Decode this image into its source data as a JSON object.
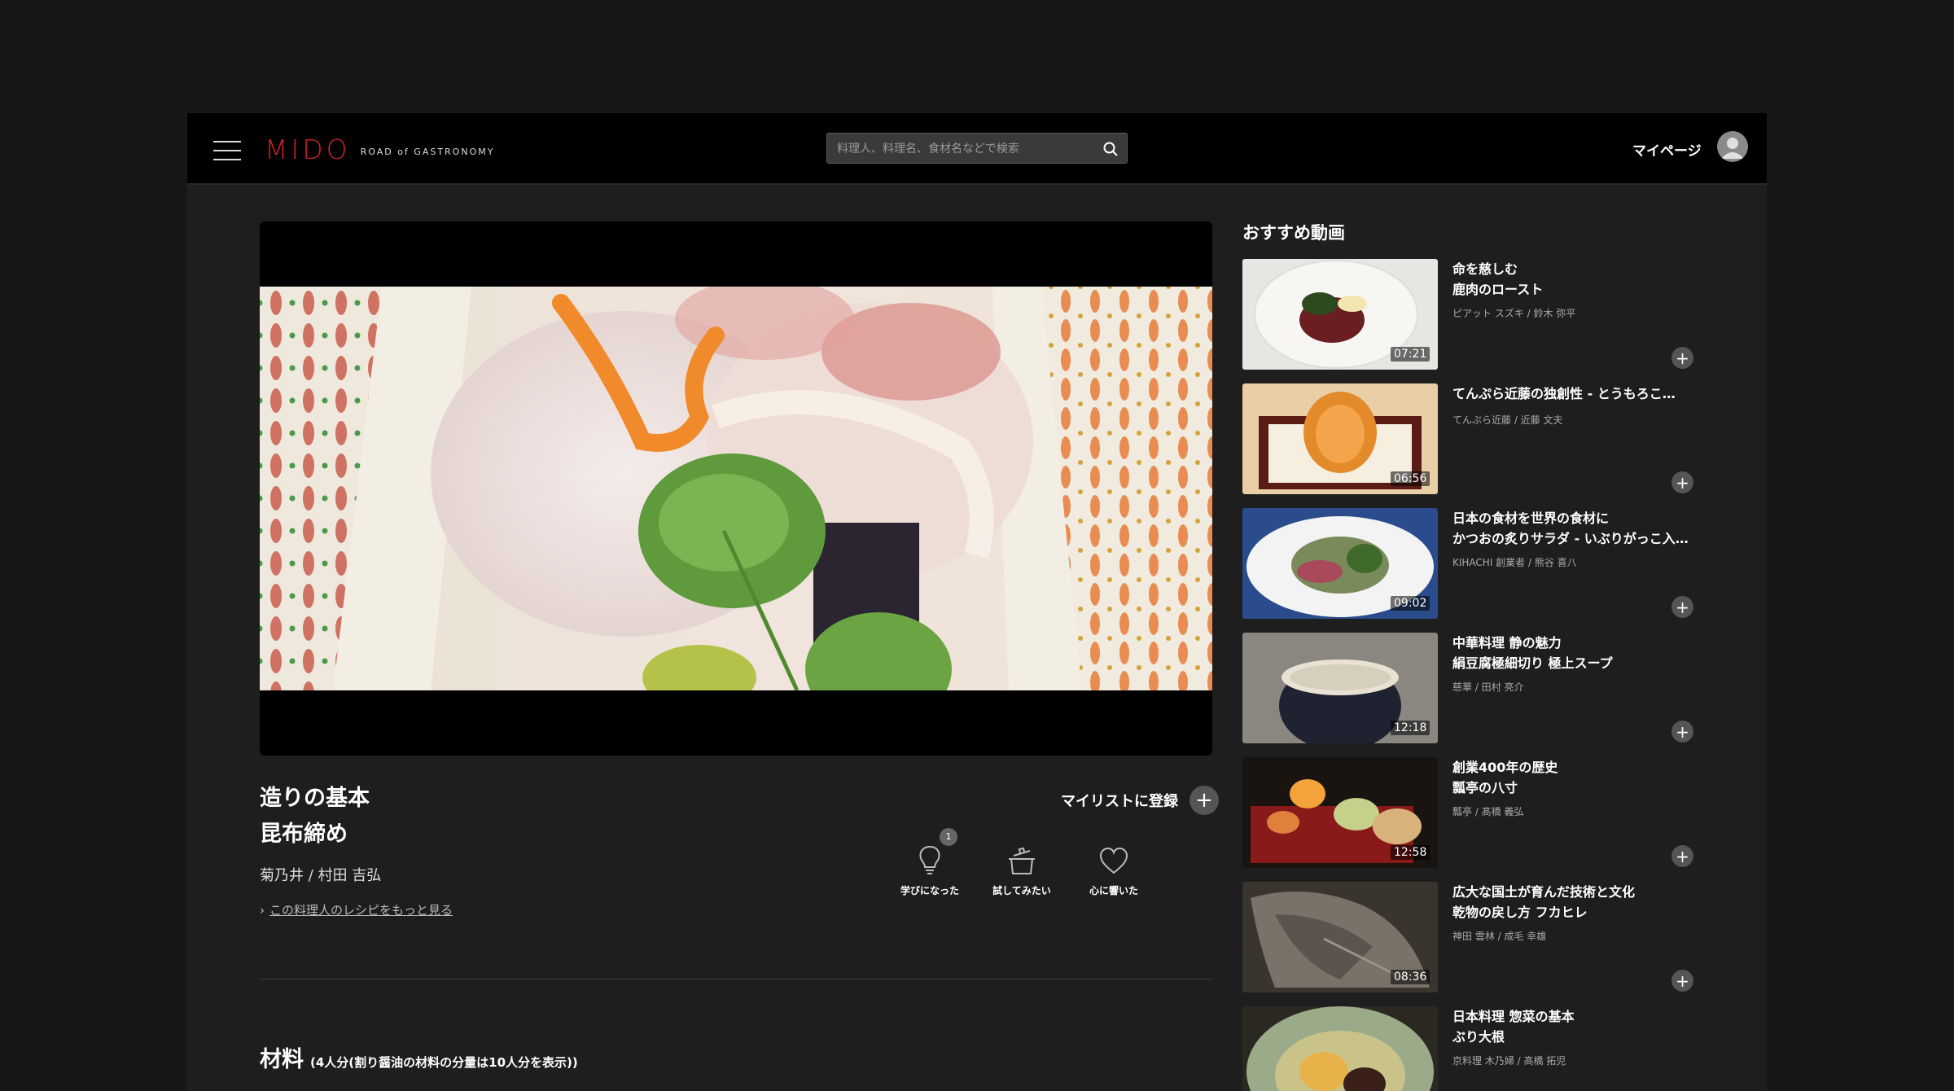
{
  "header": {
    "logo_main": "MIDO",
    "logo_sub": "ROAD of GASTRONOMY",
    "search_placeholder": "料理人、料理名、食材名などで検索",
    "mypage_label": "マイページ"
  },
  "video": {
    "title_line1": "造りの基本",
    "title_line2": "昆布締め",
    "chef": "菊乃井 / 村田 吉弘",
    "more_link": "この料理人のレシピをもっと見る",
    "mylist_label": "マイリストに登録",
    "reactions": [
      {
        "label": "学びになった",
        "icon": "lightbulb-icon",
        "count": "1"
      },
      {
        "label": "試してみたい",
        "icon": "pot-icon"
      },
      {
        "label": "心に響いた",
        "icon": "heart-icon"
      }
    ]
  },
  "ingredients": {
    "title": "材料",
    "note": "(4人分(割り醤油の材料の分量は10人分を表示))"
  },
  "recommended": {
    "heading": "おすすめ動画",
    "items": [
      {
        "line1": "命を慈しむ",
        "line2": "鹿肉のロースト",
        "chef": "ピアット スズキ / 鈴木 弥平",
        "duration": "07:21"
      },
      {
        "line1": "てんぷら近藤の独創性 - とうもろこ…",
        "line2": "",
        "chef": "てんぷら近藤 / 近藤 文夫",
        "duration": "06:56"
      },
      {
        "line1": "日本の食材を世界の食材に",
        "line2": "かつおの炙りサラダ - いぶりがっこ入…",
        "chef": "KIHACHI 創業者 / 熊谷 喜八",
        "duration": "09:02"
      },
      {
        "line1": "中華料理 静の魅力",
        "line2": "絹豆腐極細切り 極上スープ",
        "chef": "慈華 / 田村 亮介",
        "duration": "12:18"
      },
      {
        "line1": "創業400年の歴史",
        "line2": "瓢亭の八寸",
        "chef": "瓢亭 / 髙橋 義弘",
        "duration": "12:58"
      },
      {
        "line1": "広大な国土が育んだ技術と文化",
        "line2": "乾物の戻し方 フカヒレ",
        "chef": "神田 雲林 / 成毛 幸雄",
        "duration": "08:36"
      },
      {
        "line1": "日本料理 惣菜の基本",
        "line2": "ぶり大根",
        "chef": "京料理 木乃婦 / 髙橋 拓児",
        "duration": ""
      }
    ]
  },
  "colors": {
    "brand": "#c8212a",
    "background": "#1e1e1e",
    "header": "#000000"
  }
}
